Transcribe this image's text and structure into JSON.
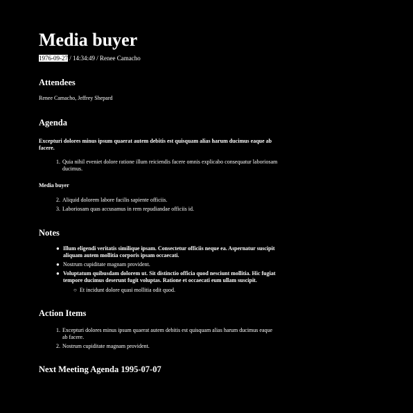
{
  "title": "Media buyer",
  "meta": {
    "date": "1976-09-27",
    "rest": "/ 14:34:49 / Renee Camacho"
  },
  "attendees": {
    "heading": "Attendees",
    "names": "Renee Camacho, Jeffrey Shepard"
  },
  "agenda": {
    "heading": "Agenda",
    "intro": "Excepturi dolores minus ipsum quaerat autem debitis est quisquam alias harum ducimus eaque ab facere.",
    "items_a": [
      {
        "marker": "1.",
        "text": "Quia nihil eveniet dolore ratione illum reiciendis facere omnis explicabo consequatur laboriosam ducimus."
      }
    ],
    "subheading": "Media buyer",
    "items_b": [
      {
        "marker": "2.",
        "text": "Aliquid dolorem labore facilis sapiente officiis."
      },
      {
        "marker": "3.",
        "text": "Laboriosam quas accusamus in rem repudiandae officiis id."
      }
    ]
  },
  "notes": {
    "heading": "Notes",
    "items": [
      {
        "marker": "●",
        "text": "Illum eligendi veritatis similique ipsam. Consectetur officiis neque ea. Aspernatur suscipit aliquam autem mollitia corporis ipsam occaecati."
      },
      {
        "marker": "●",
        "text": "Nostrum cupiditate magnam provident."
      },
      {
        "marker": "●",
        "text": "Voluptatum quibusdam dolorem ut. Sit distinctio officia quod nesciunt mollitia. Hic fugiat tempore ducimus deserunt fugit voluptas. Ratione et occaecati eum ullam suscipit."
      }
    ],
    "sub_items": [
      {
        "marker": "○",
        "text": "Et incidunt dolore quasi mollitia odit quod."
      }
    ]
  },
  "action_items": {
    "heading": "Action Items",
    "items": [
      {
        "marker": "1.",
        "text": "Excepturi dolores minus ipsum quaerat autem debitis est quisquam alias harum ducimus eaque ab facere."
      },
      {
        "marker": "2.",
        "text": "Nostrum cupiditate magnam provident."
      }
    ]
  },
  "next_meeting": {
    "heading": "Next Meeting Agenda 1995-07-07"
  }
}
